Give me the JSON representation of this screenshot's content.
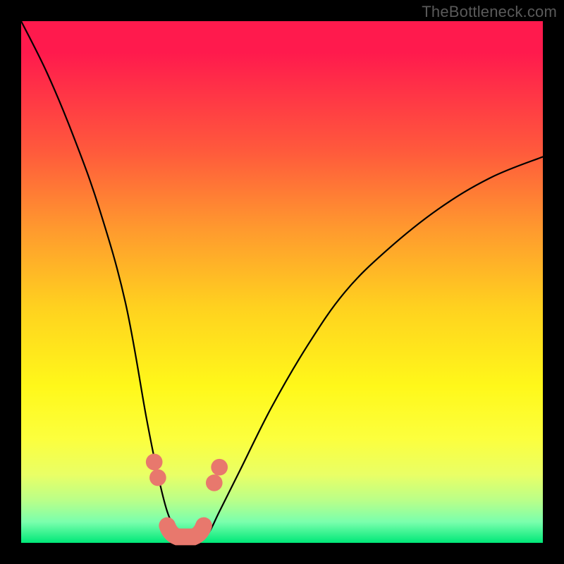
{
  "watermark": "TheBottleneck.com",
  "chart_data": {
    "type": "line",
    "title": "",
    "xlabel": "",
    "ylabel": "",
    "xlim": [
      0,
      100
    ],
    "ylim": [
      0,
      100
    ],
    "grid": false,
    "legend": false,
    "series": [
      {
        "name": "bottleneck-curve",
        "x": [
          0,
          5,
          10,
          15,
          20,
          24,
          26,
          28,
          30,
          32,
          34,
          36,
          38,
          42,
          48,
          55,
          62,
          70,
          80,
          90,
          100
        ],
        "y": [
          100,
          90,
          78,
          64,
          46,
          24,
          14,
          6,
          2,
          0,
          0,
          2,
          6,
          14,
          26,
          38,
          48,
          56,
          64,
          70,
          74
        ]
      }
    ],
    "markers": [
      {
        "name": "left-upper-dot",
        "x": 25.5,
        "y": 15.5,
        "r": 1.6
      },
      {
        "name": "left-lower-dot",
        "x": 26.2,
        "y": 12.5,
        "r": 1.6
      },
      {
        "name": "right-lower-dot",
        "x": 37.0,
        "y": 11.5,
        "r": 1.6
      },
      {
        "name": "right-upper-dot",
        "x": 38.0,
        "y": 14.5,
        "r": 1.6
      }
    ],
    "bottom_band": {
      "name": "bottom-band",
      "x_start": 28.0,
      "x_end": 35.0,
      "y": 2.5,
      "thickness": 3.2
    },
    "colors": {
      "curve": "#000000",
      "marker": "#e8786d",
      "gradient_top": "#ff1a4d",
      "gradient_bottom": "#00e878"
    }
  }
}
